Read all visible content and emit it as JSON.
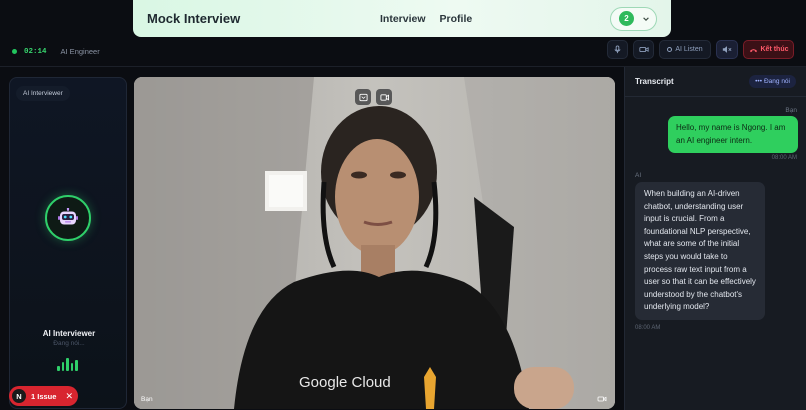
{
  "nav": {
    "brand": "Mock Interview",
    "links": [
      "Interview",
      "Profile"
    ],
    "badge": "2"
  },
  "status": {
    "timer": "02:14",
    "role": "AI Engineer",
    "listen_label": "AI Listen",
    "end_label": "Kết thúc"
  },
  "ai_panel": {
    "chip": "AI Interviewer",
    "name": "AI Interviewer",
    "speaking": "Đang nói..."
  },
  "video": {
    "label": "Bạn"
  },
  "transcript": {
    "title": "Transcript",
    "status": "Đang nói",
    "messages": [
      {
        "speaker": "Bạn",
        "text": "Hello, my name is Ngong. I am an AI engineer intern.",
        "time": "08:00 AM"
      },
      {
        "speaker": "AI",
        "text": "When building an AI-driven chatbot, understanding user input is crucial. From a foundational NLP perspective, what are some of the initial steps you would take to process raw text input from a user so that it can be effectively understood by the chatbot's underlying model?",
        "time": "08:00 AM"
      }
    ]
  },
  "issue": {
    "letter": "N",
    "label": "1 Issue"
  },
  "colors": {
    "accent_green": "#2fcf5e",
    "end_red": "#ff5a6a",
    "issue_red": "#d8252f"
  }
}
